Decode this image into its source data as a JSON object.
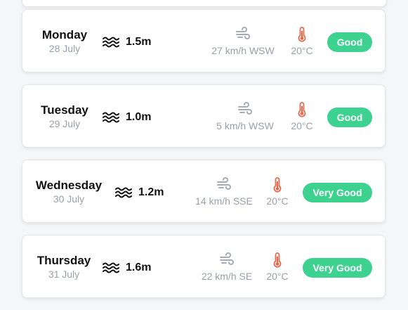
{
  "forecast": [
    {
      "day": "Monday",
      "date": "28 July",
      "wave": "1.5m",
      "wind": "27 km/h WSW",
      "temp": "20°C",
      "rating": "Good"
    },
    {
      "day": "Tuesday",
      "date": "29 July",
      "wave": "1.0m",
      "wind": "5 km/h WSW",
      "temp": "20°C",
      "rating": "Good"
    },
    {
      "day": "Wednesday",
      "date": "30 July",
      "wave": "1.2m",
      "wind": "14 km/h SSE",
      "temp": "20°C",
      "rating": "Very Good"
    },
    {
      "day": "Thursday",
      "date": "31 July",
      "wave": "1.6m",
      "wind": "22 km/h SE",
      "temp": "20°C",
      "rating": "Very Good"
    }
  ],
  "icons": {
    "wave": "waves-icon",
    "wind": "wind-icon",
    "temp": "thermometer-icon"
  },
  "colors": {
    "good": "#3dd28f",
    "temp_icon": "#e8674a",
    "muted": "#9aa0aa"
  }
}
